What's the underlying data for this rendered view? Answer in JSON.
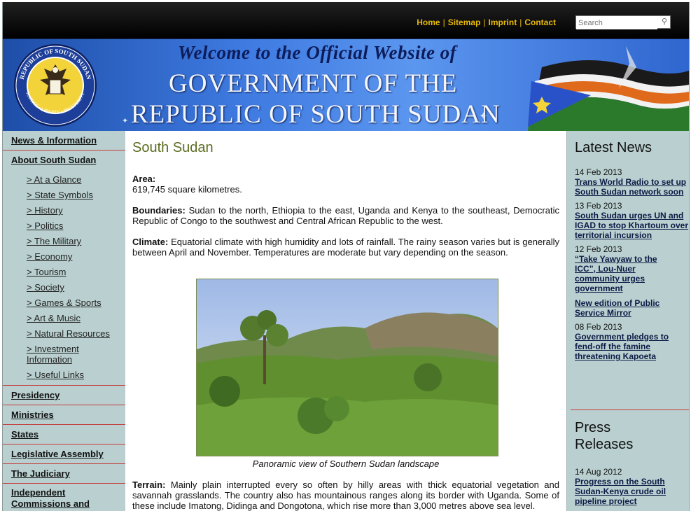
{
  "topbar": {
    "links": [
      "Home",
      "Sitemap",
      "Imprint",
      "Contact"
    ],
    "search_placeholder": "Search"
  },
  "banner": {
    "welcome": "Welcome to the Official Website of",
    "title_line1": "GOVERNMENT OF THE",
    "title_line2": "REPUBLIC OF SOUTH SUDAN",
    "emblem_top": "REPUBLIC OF SOUTH SUDAN",
    "emblem_bottom": "JUSTICE • LIBERTY • PROSPERITY"
  },
  "leftnav": {
    "news": "News & Information",
    "about": "About South Sudan",
    "sub_items": [
      "> At a Glance",
      "> State Symbols",
      "> History",
      "> Politics",
      "> The Military",
      "> Economy",
      "> Tourism",
      "> Society",
      "> Games & Sports",
      "> Art & Music",
      "> Natural Resources",
      "> Investment Information",
      "> Useful Links"
    ],
    "presidency": "Presidency",
    "ministries": "Ministries",
    "states": "States",
    "legislative": "Legislative Assembly",
    "judiciary": "The Judiciary",
    "independent": "Independent Commissions and"
  },
  "content": {
    "title": "South Sudan",
    "area_label": "Area:",
    "area_value": "619,745 square kilometres.",
    "boundaries_label": "Boundaries:",
    "boundaries_text": " Sudan to the north, Ethiopia to the east, Uganda and Kenya to the southeast, Democratic Republic of Congo to the southwest and Central African Republic to the west.",
    "climate_label": "Climate:",
    "climate_text": " Equatorial climate with high humidity and lots of rainfall. The rainy season varies but is generally between April and November. Temperatures are moderate but vary depending on the season.",
    "caption": "Panoramic view of Southern Sudan landscape",
    "terrain_label": "Terrain:",
    "terrain_text": " Mainly plain interrupted every so often by hilly areas with thick equatorial vegetation and savannah grasslands. The country also has mountainous ranges along its border with Uganda. Some of these include Imatong, Didinga and Dongotona, which rise more than 3,000 metres above sea level."
  },
  "latest_news": {
    "heading": "Latest News",
    "items": [
      {
        "date": "14 Feb 2013",
        "title": "Trans World Radio to set up South Sudan network soon"
      },
      {
        "date": "13 Feb 2013",
        "title": "South Sudan urges UN and IGAD to stop Khartoum over territorial incursion"
      },
      {
        "date": "12 Feb 2013",
        "title": "“Take Yawyaw to the ICC”, Lou-Nuer community urges government"
      },
      {
        "date": "",
        "title": "New edition of Public Service Mirror"
      },
      {
        "date": "08 Feb 2013",
        "title": "Government pledges to fend-off the famine threatening Kapoeta"
      }
    ]
  },
  "press_releases": {
    "heading": "Press Releases",
    "items": [
      {
        "date": "14 Aug 2012",
        "title": "Progress on the South Sudan-Kenya crude oil pipeline project"
      }
    ]
  },
  "colors": {
    "accent_gold": "#e8b90a",
    "nav_bg": "#bad0d0",
    "divider_red": "#c53a3a",
    "title_olive": "#5b6d21",
    "news_link": "#0b1a45"
  }
}
